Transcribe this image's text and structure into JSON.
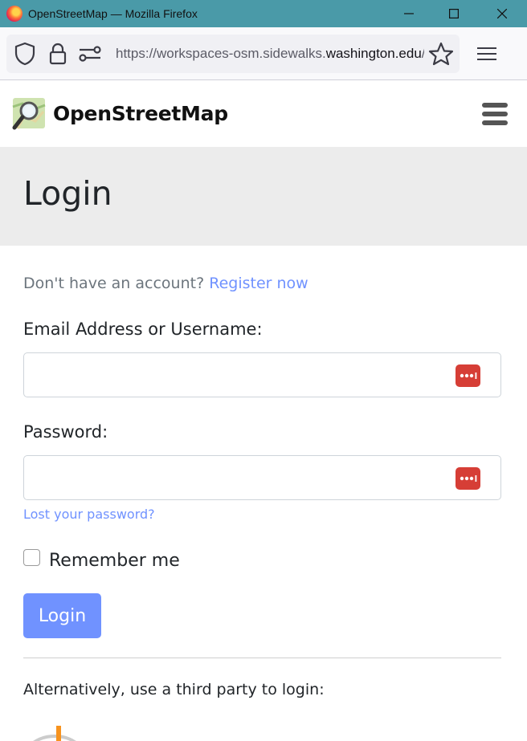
{
  "window": {
    "title": "OpenStreetMap — Mozilla Firefox"
  },
  "browser": {
    "url_prefix": "https://workspaces-osm.sidewalks.",
    "url_domain": "washington.edu",
    "url_suffix": "/"
  },
  "navbar": {
    "brand": "OpenStreetMap"
  },
  "hero": {
    "title": "Login"
  },
  "login_form": {
    "register_prompt": "Don't have an account?",
    "register_link": "Register now",
    "username_label": "Email Address or Username:",
    "username_value": "",
    "password_label": "Password:",
    "password_value": "",
    "lost_password": "Lost your password?",
    "remember_label": "Remember me",
    "remember_checked": false,
    "submit_label": "Login"
  },
  "third_party": {
    "prompt": "Alternatively, use a third party to login:"
  },
  "colors": {
    "titlebar": "#4a9aa8",
    "link": "#7092ff",
    "button": "#7092ff",
    "password_manager_badge": "#d63e36",
    "hero_background": "#ececec"
  }
}
